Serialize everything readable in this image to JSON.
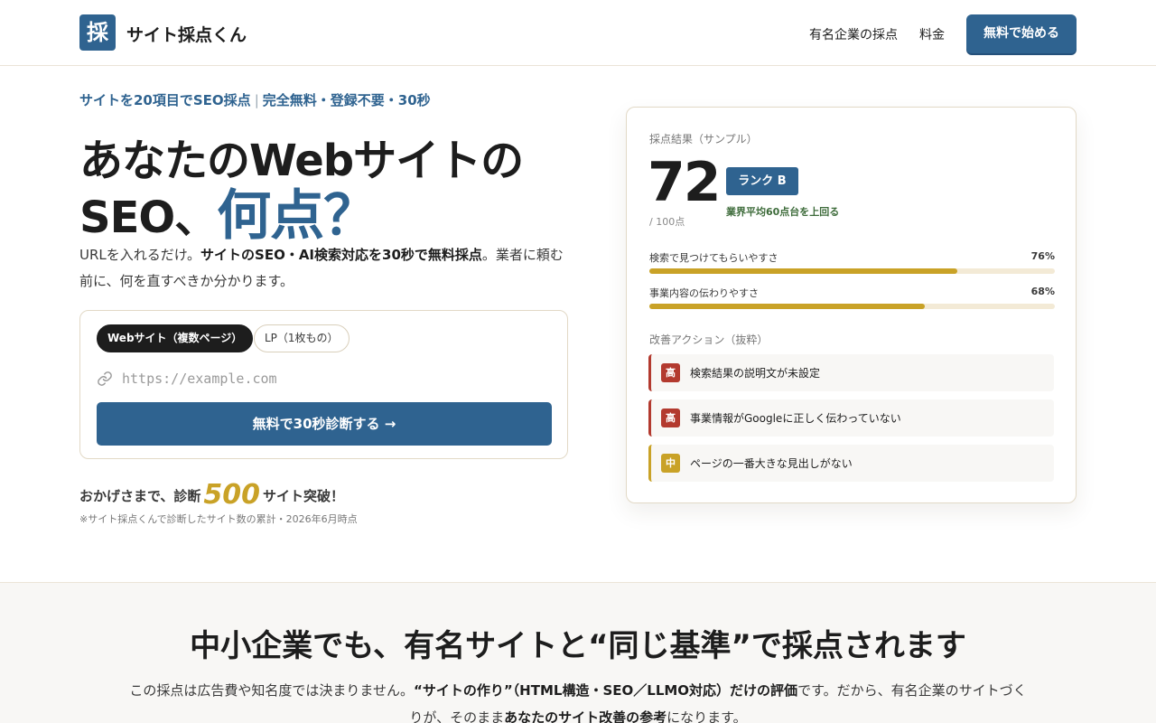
{
  "header": {
    "logo_mark": "採",
    "logo_text": "サイト採点くん",
    "nav": [
      "有名企業の採点",
      "料金"
    ],
    "cta": "無料で始める"
  },
  "hero": {
    "tagline_a": "サイトを20項目でSEO採点",
    "tagline_sep": "|",
    "tagline_b": "完全無料・登録不要・30秒",
    "title_line1": "あなたのWebサイトの",
    "title_line2_a": "SEO、",
    "title_line2_accent": "何点？",
    "lead_a": "URLを入れるだけ。",
    "lead_b": "サイトのSEO・AI検索対応を30秒で無料採点",
    "lead_c": "。業者に頼む前に、何を直すべきか分かります。"
  },
  "form": {
    "tab_active": "Webサイト（複数ページ）",
    "tab_inactive": "LP（1枚もの）",
    "url_placeholder": "https://example.com",
    "submit": "無料で30秒診断する →"
  },
  "counter": {
    "prefix": "おかげさまで、診断",
    "number": "500",
    "suffix": "サイト突破！",
    "note": "※サイト採点くんで診断したサイト数の累計・2026年6月時点"
  },
  "sample": {
    "title": "採点結果（サンプル）",
    "score": "72",
    "out_of": "/ 100点",
    "rank": "ランク B",
    "average": "業界平均60点台を上回る",
    "metrics": [
      {
        "label": "検索で見つけてもらいやすさ",
        "value": "76%",
        "fraction": 0.76
      },
      {
        "label": "事業内容の伝わりやすさ",
        "value": "68%",
        "fraction": 0.68
      }
    ],
    "actions_title": "改善アクション（抜粋）",
    "actions": [
      {
        "level": "高",
        "text": "検索結果の説明文が未設定"
      },
      {
        "level": "高",
        "text": "事業情報がGoogleに正しく伝わっていない"
      },
      {
        "level": "中",
        "text": "ページの一番大きな見出しがない"
      }
    ]
  },
  "section2": {
    "title": "中小企業でも、有名サイトと“同じ基準”で採点されます",
    "body_a": "この採点は広告費や知名度では決まりません。",
    "body_b": "“サイトの作り”（HTML構造・SEO／LLMO対応）だけの評価",
    "body_c": "です。だから、有名企業のサイトづくりが、そのまま",
    "body_d": "あなたのサイト改善の参考",
    "body_e": "になります。"
  },
  "colors": {
    "primary": "#2f6390",
    "accent_gold": "#c9a227",
    "danger": "#b33a2f",
    "text": "#1d1d1d"
  }
}
